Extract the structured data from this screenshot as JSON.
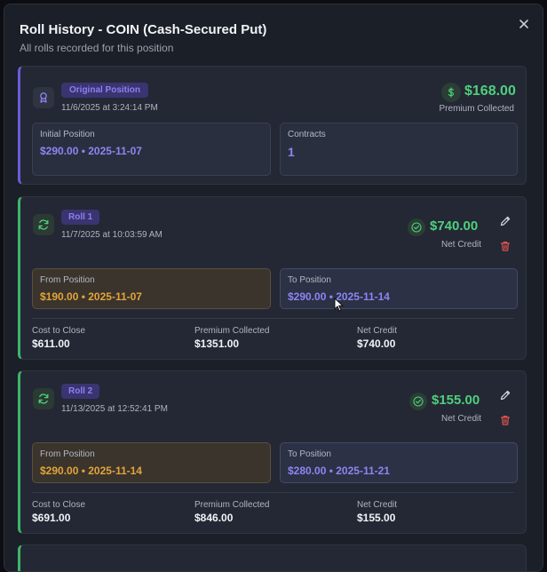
{
  "modal": {
    "title": "Roll History - COIN (Cash-Secured Put)",
    "subtitle": "All rolls recorded for this position",
    "close_icon": "close-icon"
  },
  "original": {
    "badge": "Original Position",
    "timestamp": "11/6/2025 at 3:24:14 PM",
    "amount": "$168.00",
    "amount_caption": "Premium Collected",
    "initial_label": "Initial Position",
    "initial_value": "$290.00 • 2025-11-07",
    "contracts_label": "Contracts",
    "contracts_value": "1"
  },
  "rolls": [
    {
      "badge": "Roll 1",
      "timestamp": "11/7/2025 at 10:03:59 AM",
      "amount": "$740.00",
      "amount_caption": "Net Credit",
      "from_label": "From Position",
      "from_value": "$190.00 • 2025-11-07",
      "to_label": "To Position",
      "to_value": "$290.00 • 2025-11-14",
      "cost_label": "Cost to Close",
      "cost_value": "$611.00",
      "premium_label": "Premium Collected",
      "premium_value": "$1351.00",
      "net_label": "Net Credit",
      "net_value": "$740.00"
    },
    {
      "badge": "Roll 2",
      "timestamp": "11/13/2025 at 12:52:41 PM",
      "amount": "$155.00",
      "amount_caption": "Net Credit",
      "from_label": "From Position",
      "from_value": "$290.00 • 2025-11-14",
      "to_label": "To Position",
      "to_value": "$280.00 • 2025-11-21",
      "cost_label": "Cost to Close",
      "cost_value": "$691.00",
      "premium_label": "Premium Collected",
      "premium_value": "$846.00",
      "net_label": "Net Credit",
      "net_value": "$155.00"
    }
  ],
  "colors": {
    "accent_purple": "#6d5bd8",
    "accent_green": "#3fb56b",
    "amount_green": "#4fcf7d",
    "from_orange": "#e3a43a",
    "to_violet": "#8b86f3",
    "delete_red": "#e0524f"
  },
  "icons": {
    "original": "award-icon",
    "roll": "refresh-icon",
    "money": "dollar-icon",
    "credit": "check-circle-icon",
    "edit": "pencil-icon",
    "delete": "trash-icon"
  }
}
